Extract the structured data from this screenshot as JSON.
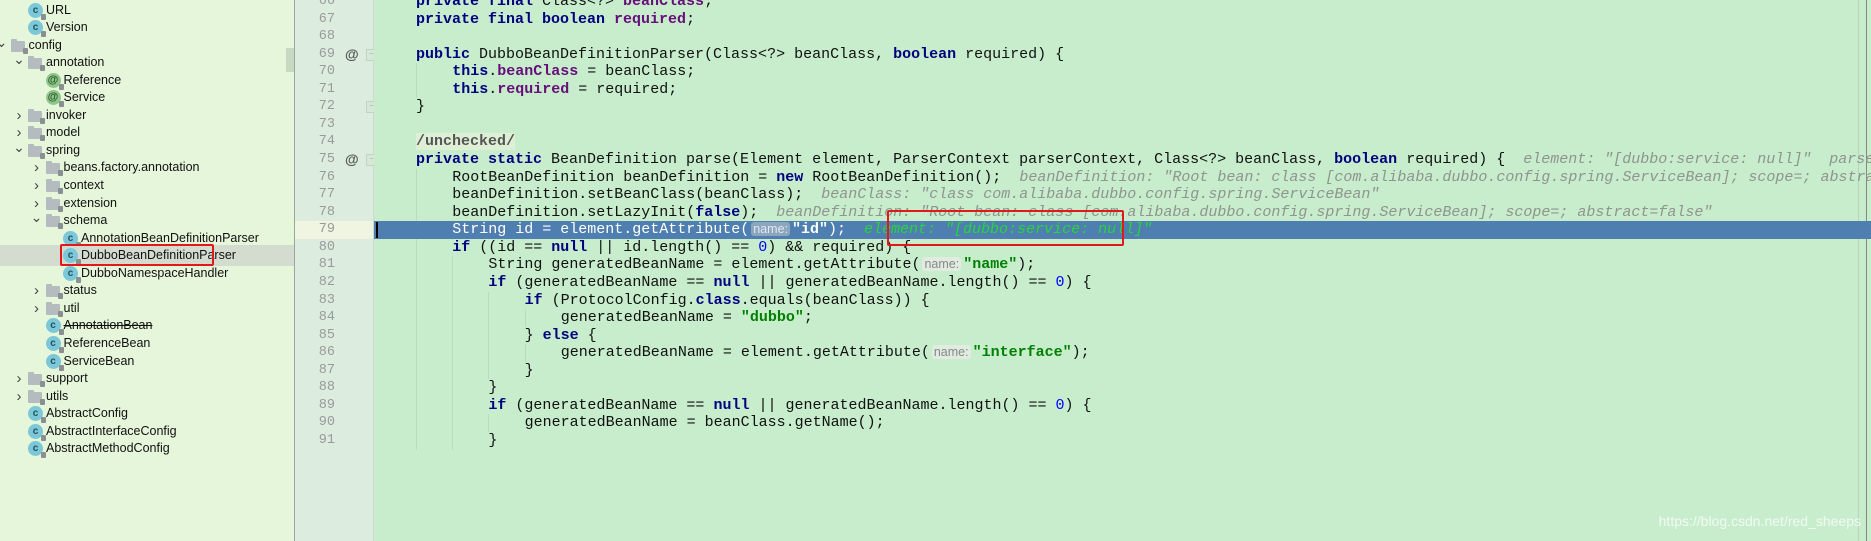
{
  "project_tree": {
    "items": [
      {
        "label": "URL",
        "icon": "class-icon",
        "depth": 2,
        "arrow": ""
      },
      {
        "label": "Version",
        "icon": "class-icon",
        "depth": 2,
        "arrow": ""
      },
      {
        "label": "config",
        "icon": "package-icon",
        "depth": 1,
        "arrow": "expanded"
      },
      {
        "label": "annotation",
        "icon": "package-icon",
        "depth": 2,
        "arrow": "expanded"
      },
      {
        "label": "Reference",
        "icon": "annotation-icon",
        "depth": 3,
        "arrow": ""
      },
      {
        "label": "Service",
        "icon": "annotation-icon",
        "depth": 3,
        "arrow": ""
      },
      {
        "label": "invoker",
        "icon": "package-icon",
        "depth": 2,
        "arrow": "collapsed"
      },
      {
        "label": "model",
        "icon": "package-icon",
        "depth": 2,
        "arrow": "collapsed"
      },
      {
        "label": "spring",
        "icon": "package-icon",
        "depth": 2,
        "arrow": "expanded"
      },
      {
        "label": "beans.factory.annotation",
        "icon": "package-icon",
        "depth": 3,
        "arrow": "collapsed"
      },
      {
        "label": "context",
        "icon": "package-icon",
        "depth": 3,
        "arrow": "collapsed"
      },
      {
        "label": "extension",
        "icon": "package-icon",
        "depth": 3,
        "arrow": "collapsed"
      },
      {
        "label": "schema",
        "icon": "package-icon",
        "depth": 3,
        "arrow": "expanded"
      },
      {
        "label": "AnnotationBeanDefinitionParser",
        "icon": "class-icon",
        "depth": 4,
        "arrow": ""
      },
      {
        "label": "DubboBeanDefinitionParser",
        "icon": "class-icon",
        "depth": 4,
        "arrow": "",
        "selected": true,
        "highlighted": true
      },
      {
        "label": "DubboNamespaceHandler",
        "icon": "class-icon",
        "depth": 4,
        "arrow": ""
      },
      {
        "label": "status",
        "icon": "package-icon",
        "depth": 3,
        "arrow": "collapsed"
      },
      {
        "label": "util",
        "icon": "package-icon",
        "depth": 3,
        "arrow": "collapsed"
      },
      {
        "label": "AnnotationBean",
        "icon": "class-icon",
        "depth": 3,
        "arrow": "",
        "deprecated": true
      },
      {
        "label": "ReferenceBean",
        "icon": "class-icon",
        "depth": 3,
        "arrow": ""
      },
      {
        "label": "ServiceBean",
        "icon": "class-icon",
        "depth": 3,
        "arrow": ""
      },
      {
        "label": "support",
        "icon": "package-icon",
        "depth": 2,
        "arrow": "collapsed"
      },
      {
        "label": "utils",
        "icon": "package-icon",
        "depth": 2,
        "arrow": "collapsed"
      },
      {
        "label": "AbstractConfig",
        "icon": "abstract-class-icon",
        "depth": 2,
        "arrow": ""
      },
      {
        "label": "AbstractInterfaceConfig",
        "icon": "abstract-class-icon",
        "depth": 2,
        "arrow": ""
      },
      {
        "label": "AbstractMethodConfig",
        "icon": "abstract-class-icon",
        "depth": 2,
        "arrow": ""
      }
    ]
  },
  "editor": {
    "current_line": 79,
    "lines": [
      {
        "n": 66,
        "tokens": [
          [
            "kw",
            "private final "
          ],
          [
            "",
            "Class<?> "
          ],
          [
            "fld",
            "beanClass"
          ],
          [
            "",
            ";"
          ]
        ],
        "indent": 1
      },
      {
        "n": 67,
        "tokens": [
          [
            "kw",
            "private final boolean "
          ],
          [
            "fld",
            "required"
          ],
          [
            "",
            ";"
          ]
        ],
        "indent": 1
      },
      {
        "n": 68,
        "tokens": [],
        "indent": 1
      },
      {
        "n": 69,
        "override": true,
        "fold": "start",
        "tokens": [
          [
            "kw",
            "public "
          ],
          [
            "",
            "DubboBeanDefinitionParser(Class<?> beanClass, "
          ],
          [
            "kw",
            "boolean "
          ],
          [
            "",
            "required) {"
          ]
        ],
        "indent": 1
      },
      {
        "n": 70,
        "tokens": [
          [
            "kw",
            "this"
          ],
          [
            "",
            "."
          ],
          [
            "fld",
            "beanClass"
          ],
          [
            "",
            " = beanClass;"
          ]
        ],
        "indent": 2
      },
      {
        "n": 71,
        "tokens": [
          [
            "kw",
            "this"
          ],
          [
            "",
            "."
          ],
          [
            "fld",
            "required"
          ],
          [
            "",
            " = required;"
          ]
        ],
        "indent": 2
      },
      {
        "n": 72,
        "fold": "end",
        "tokens": [
          [
            "",
            "}"
          ]
        ],
        "indent": 1
      },
      {
        "n": 73,
        "tokens": [],
        "indent": 1
      },
      {
        "n": 74,
        "tokens": [
          [
            "cmt-anno",
            "/unchecked/"
          ]
        ],
        "indent": 1
      },
      {
        "n": 75,
        "override": true,
        "fold": "start",
        "tokens": [
          [
            "kw",
            "private static "
          ],
          [
            "",
            "BeanDefinition parse(Element element, ParserContext parserContext, Class<?> beanClass, "
          ],
          [
            "kw",
            "boolean "
          ],
          [
            "",
            "required) {  "
          ],
          [
            "inline-debug",
            "element: \"[dubbo:service: null]\"  parserContext: ..."
          ]
        ],
        "indent": 1
      },
      {
        "n": 76,
        "tokens": [
          [
            "",
            "RootBeanDefinition beanDefinition = "
          ],
          [
            "kw",
            "new "
          ],
          [
            "",
            "RootBeanDefinition();  "
          ],
          [
            "inline-debug",
            "beanDefinition: \"Root bean: class [com.alibaba.dubbo.config.spring.ServiceBean]; scope=; abstract=false\""
          ]
        ],
        "indent": 2
      },
      {
        "n": 77,
        "tokens": [
          [
            "",
            "beanDefinition.setBeanClass(beanClass);  "
          ],
          [
            "inline-debug",
            "beanClass: \"class com.alibaba.dubbo.config.spring.ServiceBean\""
          ]
        ],
        "indent": 2
      },
      {
        "n": 78,
        "tokens": [
          [
            "",
            "beanDefinition.setLazyInit("
          ],
          [
            "kw",
            "false"
          ],
          [
            "",
            ");  "
          ],
          [
            "inline-debug",
            "beanDefinition: \"Root bean: class [com.alibaba.dubbo.config.spring.ServiceBean]; scope=; abstract=false\""
          ]
        ],
        "indent": 2
      },
      {
        "n": 79,
        "tokens": [
          [
            "",
            "String id = element.getAttribute("
          ],
          [
            "hint",
            "name:"
          ],
          [
            "str",
            "\"id\""
          ],
          [
            "",
            ");  "
          ],
          [
            "inline-debug",
            "element: \"[dubbo:service: null]\""
          ]
        ],
        "indent": 2
      },
      {
        "n": 80,
        "tokens": [
          [
            "kw",
            "if "
          ],
          [
            "",
            "((id == "
          ],
          [
            "kw",
            "null "
          ],
          [
            "",
            "|| id.length() == "
          ],
          [
            "num",
            "0"
          ],
          [
            "",
            ") && required) {"
          ]
        ],
        "indent": 2
      },
      {
        "n": 81,
        "tokens": [
          [
            "",
            "String generatedBeanName = element.getAttribute("
          ],
          [
            "hint",
            "name:"
          ],
          [
            "str",
            "\"name\""
          ],
          [
            "",
            ");"
          ]
        ],
        "indent": 3
      },
      {
        "n": 82,
        "tokens": [
          [
            "kw",
            "if "
          ],
          [
            "",
            "(generatedBeanName == "
          ],
          [
            "kw",
            "null "
          ],
          [
            "",
            "|| generatedBeanName.length() == "
          ],
          [
            "num",
            "0"
          ],
          [
            "",
            ") {"
          ]
        ],
        "indent": 3
      },
      {
        "n": 83,
        "tokens": [
          [
            "kw",
            "if "
          ],
          [
            "",
            "(ProtocolConfig."
          ],
          [
            "kw",
            "class"
          ],
          [
            "",
            ".equals(beanClass)) {"
          ]
        ],
        "indent": 4
      },
      {
        "n": 84,
        "tokens": [
          [
            "",
            "generatedBeanName = "
          ],
          [
            "str",
            "\"dubbo\""
          ],
          [
            "",
            ";"
          ]
        ],
        "indent": 5
      },
      {
        "n": 85,
        "tokens": [
          [
            "",
            "} "
          ],
          [
            "kw",
            "else "
          ],
          [
            "",
            "{"
          ]
        ],
        "indent": 4
      },
      {
        "n": 86,
        "tokens": [
          [
            "",
            "generatedBeanName = element.getAttribute("
          ],
          [
            "hint",
            "name:"
          ],
          [
            "str",
            "\"interface\""
          ],
          [
            "",
            ");"
          ]
        ],
        "indent": 5
      },
      {
        "n": 87,
        "tokens": [
          [
            "",
            "}"
          ]
        ],
        "indent": 4
      },
      {
        "n": 88,
        "tokens": [
          [
            "",
            "}"
          ]
        ],
        "indent": 3
      },
      {
        "n": 89,
        "tokens": [
          [
            "kw",
            "if "
          ],
          [
            "",
            "(generatedBeanName == "
          ],
          [
            "kw",
            "null "
          ],
          [
            "",
            "|| generatedBeanName.length() == "
          ],
          [
            "num",
            "0"
          ],
          [
            "",
            ") {"
          ]
        ],
        "indent": 3
      },
      {
        "n": 90,
        "tokens": [
          [
            "",
            "generatedBeanName = beanClass.getName();"
          ]
        ],
        "indent": 4
      },
      {
        "n": 91,
        "tokens": [
          [
            "",
            "}"
          ]
        ],
        "indent": 3
      }
    ],
    "highlight_box_line": 79,
    "highlight_box_text": "element: \"[dubbo:service: null]\""
  },
  "watermark": "https://blog.csdn.net/red_sheeps",
  "colors": {
    "editor_bg": "#c7edcc",
    "current_line_bg": "#4f7eb0",
    "annotation_box": "#e01a1a",
    "keyword": "#000080",
    "field": "#660e7a",
    "string": "#008000",
    "number": "#0000ff",
    "inline_debug_current": "#27d53a"
  }
}
